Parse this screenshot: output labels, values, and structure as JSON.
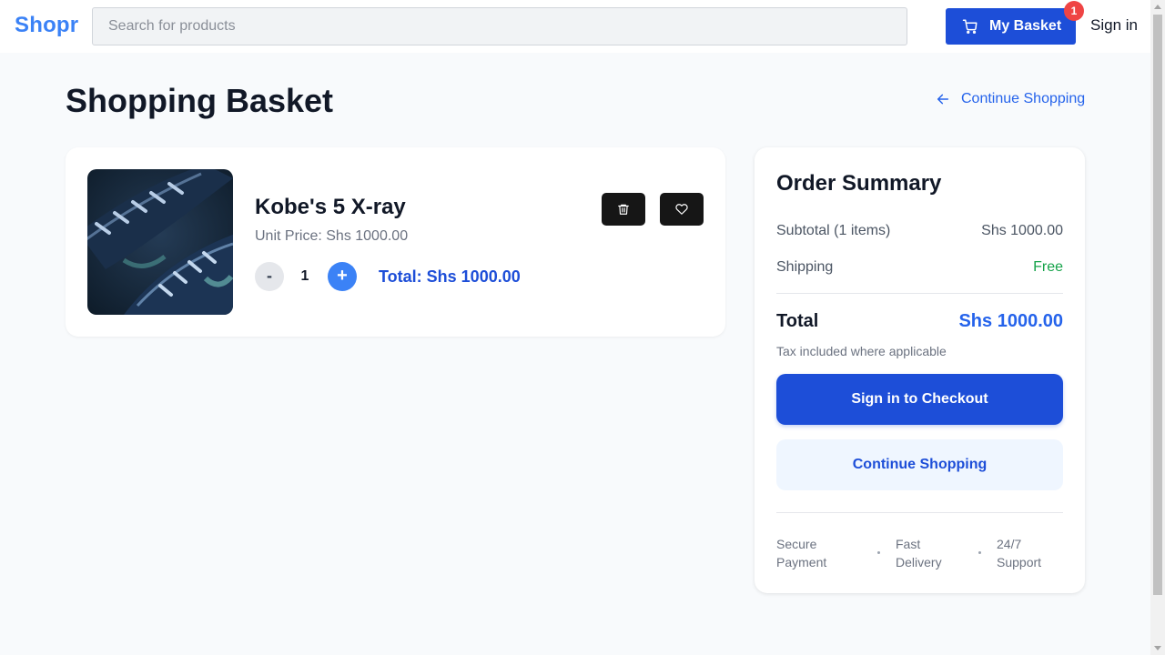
{
  "header": {
    "logo": "Shopr",
    "search_placeholder": "Search for products",
    "basket_label": "My Basket",
    "basket_count": "1",
    "signin_label": "Sign in"
  },
  "page": {
    "title": "Shopping Basket",
    "continue_shopping_link": "Continue Shopping"
  },
  "basket": {
    "items": [
      {
        "name": "Kobe's 5 X-ray",
        "unit_price": "Unit Price: Shs 1000.00",
        "quantity": "1",
        "minus_label": "-",
        "plus_label": "+",
        "total": "Total: Shs 1000.00",
        "image_icon": "sneaker-image"
      }
    ]
  },
  "summary": {
    "title": "Order Summary",
    "subtotal_label": "Subtotal (1 items)",
    "subtotal_value": "Shs 1000.00",
    "shipping_label": "Shipping",
    "shipping_value": "Free",
    "total_label": "Total",
    "total_value": "Shs 1000.00",
    "tax_note": "Tax included where applicable",
    "checkout_label": "Sign in to Checkout",
    "continue_label": "Continue Shopping",
    "features": [
      {
        "line1": "Secure",
        "line2": "Payment"
      },
      {
        "line1": "Fast",
        "line2": "Delivery"
      },
      {
        "line1": "24/7",
        "line2": "Support"
      }
    ]
  },
  "colors": {
    "brand": "#3b82f6",
    "primary": "#1d4ed8",
    "free": "#16a34a",
    "badge": "#ef4444"
  }
}
